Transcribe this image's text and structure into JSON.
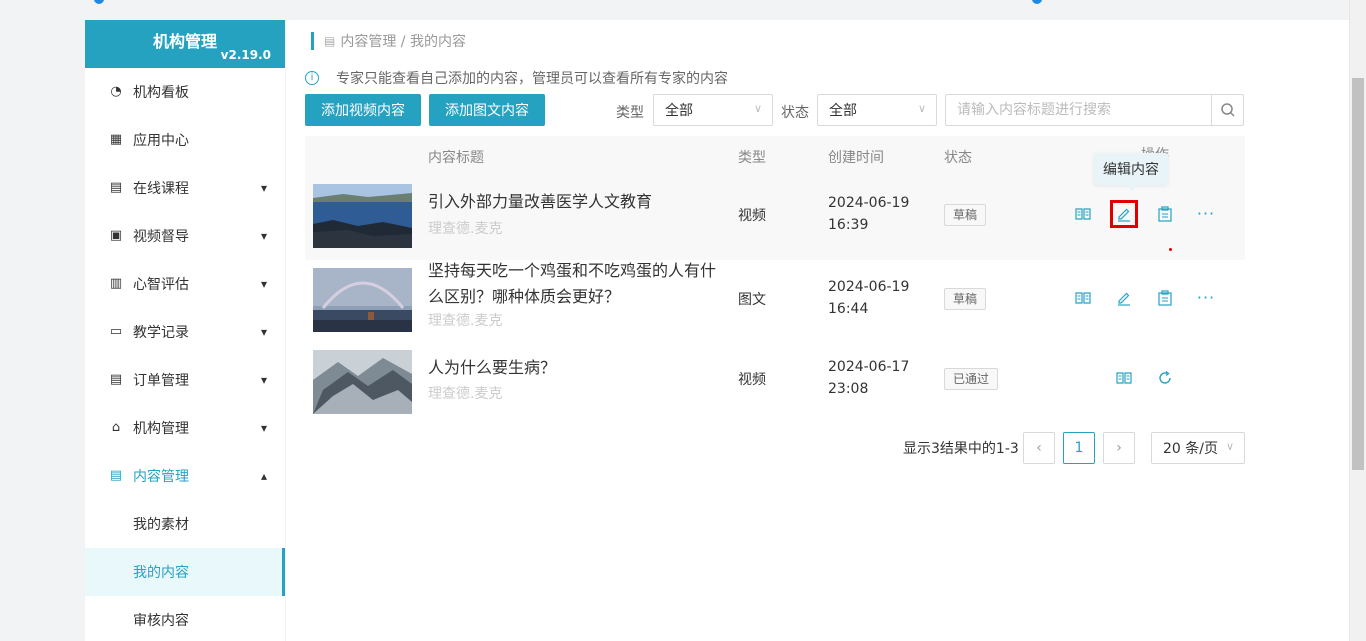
{
  "sidebar": {
    "brand_title": "机构管理",
    "version": "v2.19.0",
    "items": [
      {
        "label": "机构看板",
        "icon": "pie-chart-icon"
      },
      {
        "label": "应用中心",
        "icon": "grid-icon"
      },
      {
        "label": "在线课程",
        "icon": "book-icon",
        "expandable": true
      },
      {
        "label": "视频督导",
        "icon": "play-square-icon",
        "expandable": true
      },
      {
        "label": "心智评估",
        "icon": "clipboard-icon",
        "expandable": true
      },
      {
        "label": "教学记录",
        "icon": "video-camera-icon",
        "expandable": true
      },
      {
        "label": "订单管理",
        "icon": "receipt-icon",
        "expandable": true
      },
      {
        "label": "机构管理",
        "icon": "bank-icon",
        "expandable": true
      },
      {
        "label": "内容管理",
        "icon": "document-icon",
        "expanded": true
      }
    ],
    "sub_items": [
      {
        "label": "我的素材"
      },
      {
        "label": "我的内容",
        "active": true
      },
      {
        "label": "审核内容"
      }
    ]
  },
  "breadcrumb": "内容管理 / 我的内容",
  "notice": "专家只能查看自己添加的内容，管理员可以查看所有专家的内容",
  "toolbar": {
    "add_video_label": "添加视频内容",
    "add_article_label": "添加图文内容",
    "type_label": "类型",
    "type_value": "全部",
    "status_label": "状态",
    "status_value": "全部",
    "search_placeholder": "请输入内容标题进行搜索"
  },
  "table": {
    "headers": {
      "title": "内容标题",
      "type": "类型",
      "created": "创建时间",
      "status": "状态",
      "actions": "操作"
    },
    "rows": [
      {
        "title": "引入外部力量改善医学人文教育",
        "author": "理查德.麦克",
        "type": "视频",
        "date": "2024-06-19",
        "time": "16:39",
        "status": "草稿"
      },
      {
        "title": "坚持每天吃一个鸡蛋和不吃鸡蛋的人有什么区别？哪种体质会更好？",
        "author": "理查德.麦克",
        "type": "图文",
        "date": "2024-06-19",
        "time": "16:44",
        "status": "草稿"
      },
      {
        "title": "人为什么要生病？",
        "author": "理查德.麦克",
        "type": "视频",
        "date": "2024-06-17",
        "time": "23:08",
        "status": "已通过"
      }
    ]
  },
  "tooltip": "编辑内容",
  "pagination": {
    "summary": "显示3结果中的1-3",
    "current_page": "1",
    "page_size": "20 条/页"
  },
  "colors": {
    "accent": "#26a2c1",
    "highlight": "#e00000"
  }
}
